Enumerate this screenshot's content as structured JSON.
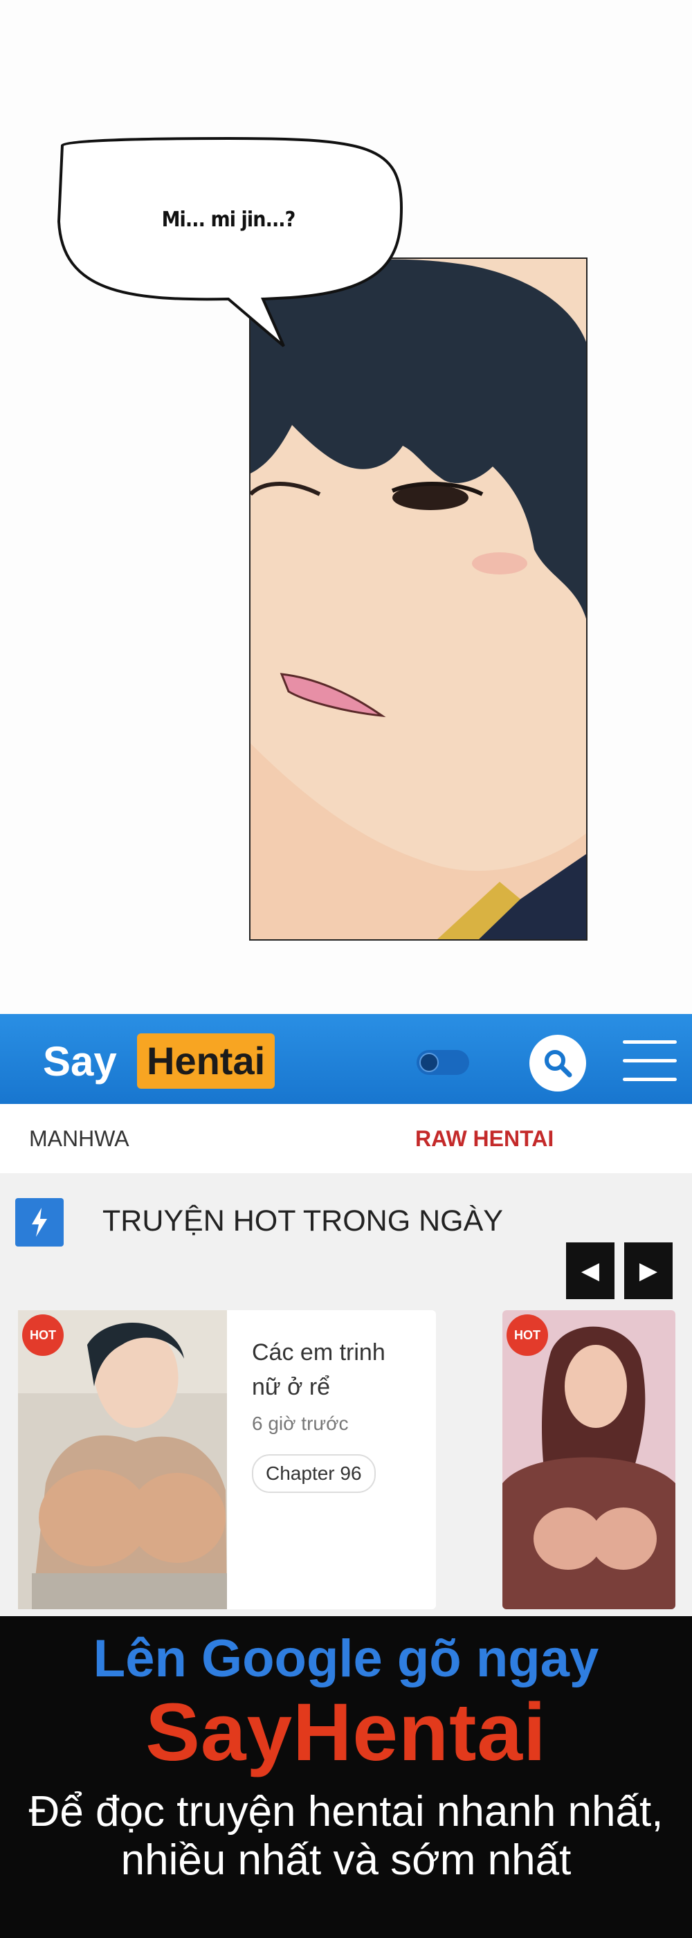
{
  "comic": {
    "speech": "Mi... mi jin...?"
  },
  "site": {
    "logo_say": "Say",
    "logo_hentai": "Hentai",
    "nav": [
      "MANHWA",
      "RAW HENTAI"
    ],
    "section_title": "TRUYỆN HOT TRONG NGÀY",
    "cards": [
      {
        "badge": "HOT",
        "title": "Các em trinh nữ ở rể",
        "time": "6 giờ trước",
        "chapter": "Chapter 96"
      },
      {
        "badge": "HOT"
      }
    ],
    "colors": {
      "header_blue": "#1876cf",
      "logo_orange": "#f8a522",
      "raw_red": "#c42a2a"
    }
  },
  "banner": {
    "line1": "Lên Google gõ ngay",
    "line2": "SayHentai",
    "line3": "Để đọc truyện hentai nhanh nhất, nhiều nhất và sớm nhất"
  }
}
